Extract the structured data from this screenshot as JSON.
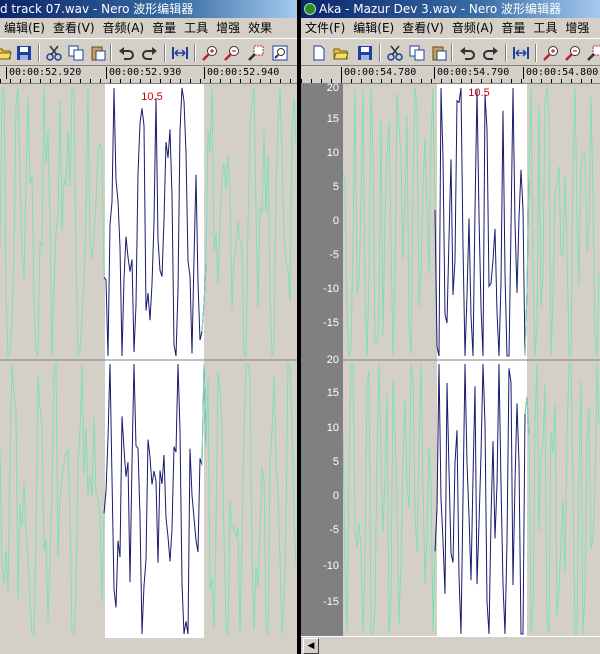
{
  "left_window": {
    "title": "d track 07.wav - Nero 波形编辑器",
    "menu": [
      "编辑(E)",
      "查看(V)",
      "音频(A)",
      "音量",
      "工具",
      "增强",
      "效果"
    ],
    "ruler_labels": [
      "00:00:52.920",
      "00:00:52.930",
      "00:00:52.940"
    ],
    "selection_label": "10.5"
  },
  "right_window": {
    "title": "Aka - Mazur Dev 3.wav - Nero 波形编辑器",
    "menu": [
      "文件(F)",
      "编辑(E)",
      "查看(V)",
      "音频(A)",
      "音量",
      "工具",
      "增强"
    ],
    "ruler_labels": [
      "00:00:54.780",
      "00:00:54.790",
      "00:00:54.800"
    ],
    "selection_label": "10.5",
    "scale_top": [
      "20",
      "15",
      "10",
      "5",
      "0",
      "-5",
      "-10",
      "-15"
    ],
    "scale_bottom": [
      "20",
      "15",
      "10",
      "5",
      "0",
      "-5",
      "-10",
      "-15"
    ]
  },
  "icons": [
    "open-icon",
    "save-icon",
    "cut-icon",
    "copy-icon",
    "paste-icon",
    "undo-icon",
    "redo-icon",
    "fit-icon",
    "zoom-in-icon",
    "zoom-out-icon",
    "zoom-selection-icon",
    "zoom-full-icon"
  ],
  "colors": {
    "waveform": "#7fe0b4",
    "waveform_selected": "#1a1a6e",
    "selection_bg": "#ffffff",
    "background": "#000000",
    "selection_label": "#cc0000",
    "title_start": "#0a246a",
    "title_end": "#a6caf0"
  }
}
